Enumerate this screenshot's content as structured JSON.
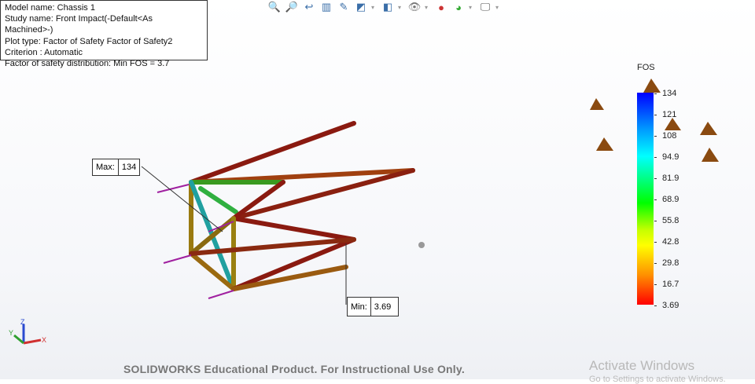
{
  "info": {
    "model_name": "Model name: Chassis 1",
    "study_name": "Study name: Front Impact(-Default<As Machined>-)",
    "plot_type": "Plot type: Factor of Safety Factor of Safety2",
    "criterion": "Criterion : Automatic",
    "distribution": "Factor of safety distribution: Min FOS = 3.7"
  },
  "toolbar": [
    "zoom-to-fit-icon",
    "zoom-to-area-icon",
    "previous-view-icon",
    "section-view-icon",
    "dynamic-annotation-icon",
    "view-orientation-icon",
    "display-style-icon",
    "hide-show-icon",
    "edit-appearance-icon",
    "apply-scene-icon",
    "view-settings-icon"
  ],
  "probes": {
    "max_label": "Max:",
    "max_value": "134",
    "min_label": "Min:",
    "min_value": "3.69"
  },
  "legend": {
    "title": "FOS",
    "labels": [
      "134",
      "121",
      "108",
      "94.9",
      "81.9",
      "68.9",
      "55.8",
      "42.8",
      "29.8",
      "16.7",
      "3.69"
    ],
    "max": 134,
    "min": 3.69
  },
  "triad": {
    "x": "X",
    "y": "Y",
    "z": "Z"
  },
  "watermark": "SOLIDWORKS Educational Product. For Instructional Use Only.",
  "activation": {
    "title": "Activate Windows",
    "subtitle": "Go to Settings to activate Windows."
  }
}
